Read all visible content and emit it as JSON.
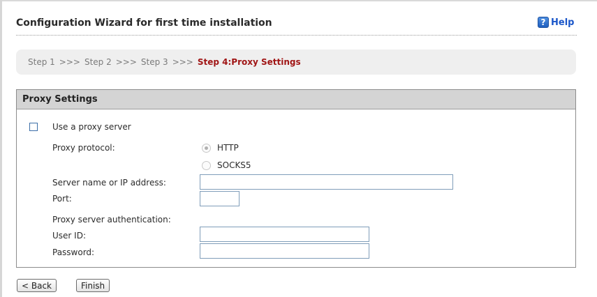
{
  "header": {
    "title": "Configuration Wizard for first time installation",
    "help_label": "Help",
    "help_icon": "?"
  },
  "steps": {
    "step1": "Step 1",
    "step2": "Step 2",
    "step3": "Step 3",
    "separator": ">>>",
    "current": "Step 4:Proxy Settings"
  },
  "panel": {
    "title": "Proxy Settings",
    "use_proxy_label": "Use a proxy server",
    "use_proxy_checked": false,
    "protocol_label": "Proxy protocol:",
    "protocol_options": [
      "HTTP",
      "SOCKS5"
    ],
    "protocol_selected": "HTTP",
    "server_label": "Server name or IP address:",
    "server_value": "",
    "port_label": "Port:",
    "port_value": "",
    "auth_label": "Proxy server authentication:",
    "userid_label": "User ID:",
    "userid_value": "",
    "password_label": "Password:",
    "password_value": ""
  },
  "buttons": {
    "back": "< Back",
    "finish": "Finish"
  }
}
